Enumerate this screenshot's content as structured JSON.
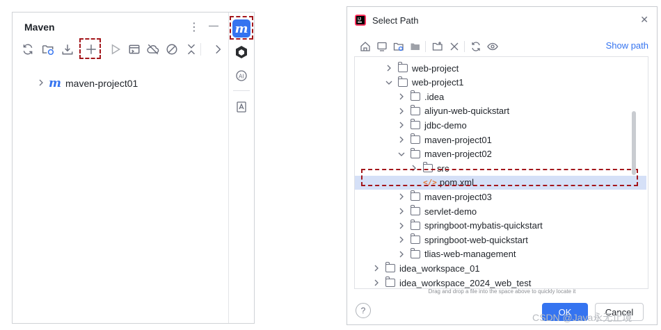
{
  "maven_panel": {
    "title": "Maven",
    "more_glyph": "⋮",
    "minimize_glyph": "—",
    "toolbar_icons": [
      "reload-icon",
      "reload-folder-icon",
      "download-icon",
      "add-icon",
      "run-icon",
      "execute-goal-icon",
      "offline-icon",
      "skip-tests-icon",
      "collapse-icon",
      "chevron-right-icon"
    ],
    "project_name": "maven-project01",
    "maven_logo": "m",
    "highlight_color": "#a3161b"
  },
  "dialog": {
    "title": "Select Path",
    "show_path": "Show path",
    "tree": [
      {
        "label": "web-project",
        "depth": 1,
        "expanded": false,
        "type": "folder"
      },
      {
        "label": "web-project1",
        "depth": 1,
        "expanded": true,
        "type": "folder"
      },
      {
        "label": ".idea",
        "depth": 2,
        "expanded": false,
        "type": "folder"
      },
      {
        "label": "aliyun-web-quickstart",
        "depth": 2,
        "expanded": false,
        "type": "folder"
      },
      {
        "label": "jdbc-demo",
        "depth": 2,
        "expanded": false,
        "type": "folder"
      },
      {
        "label": "maven-project01",
        "depth": 2,
        "expanded": false,
        "type": "folder"
      },
      {
        "label": "maven-project02",
        "depth": 2,
        "expanded": true,
        "type": "folder"
      },
      {
        "label": "src",
        "depth": 3,
        "expanded": false,
        "type": "folder"
      },
      {
        "label": "pom.xml",
        "depth": 3,
        "expanded": null,
        "type": "file",
        "selected": true
      },
      {
        "label": "maven-project03",
        "depth": 2,
        "expanded": false,
        "type": "folder"
      },
      {
        "label": "servlet-demo",
        "depth": 2,
        "expanded": false,
        "type": "folder"
      },
      {
        "label": "springboot-mybatis-quickstart",
        "depth": 2,
        "expanded": false,
        "type": "folder"
      },
      {
        "label": "springboot-web-quickstart",
        "depth": 2,
        "expanded": false,
        "type": "folder"
      },
      {
        "label": "tlias-web-management",
        "depth": 2,
        "expanded": false,
        "type": "folder"
      },
      {
        "label": "idea_workspace_01",
        "depth": 0,
        "expanded": false,
        "type": "folder"
      },
      {
        "label": "idea_workspace_2024_web_test",
        "depth": 0,
        "expanded": false,
        "type": "folder"
      }
    ],
    "drag_hint": "Drag and drop a file into the space above to quickly locate it",
    "help_label": "?",
    "ok_label": "OK",
    "cancel_label": "Cancel",
    "close_glyph": "✕",
    "accent_color": "#3574f0",
    "selection_color": "#d5e0f7"
  },
  "watermark": "CSDN @Java永无止境"
}
